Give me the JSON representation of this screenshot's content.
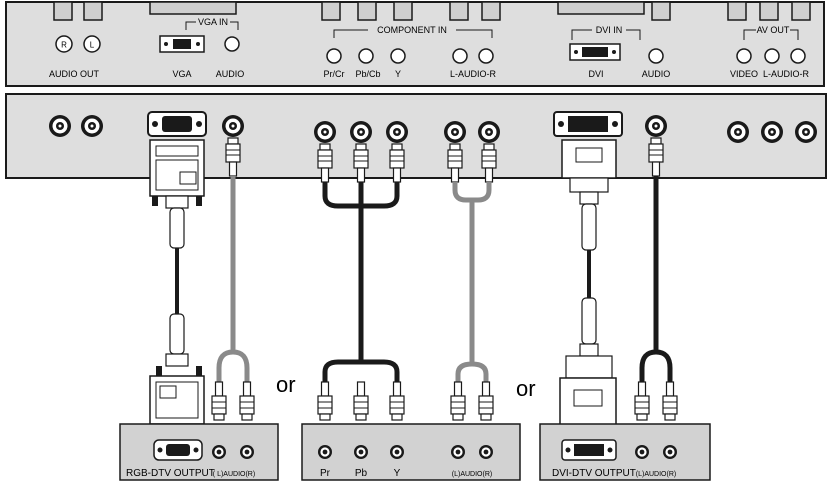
{
  "top_panel": {
    "labels": {
      "audio_out": "AUDIO OUT",
      "vga": "VGA",
      "vga_audio": "AUDIO",
      "vga_in": "VGA IN",
      "component_in": "COMPONENT  IN",
      "pr_cr": "Pr/Cr",
      "pb_cb": "Pb/Cb",
      "y": "Y",
      "l_audio_r": "L-AUDIO-R",
      "dvi_in": "DVI IN",
      "dvi": "DVI",
      "dvi_audio": "AUDIO",
      "av_out": "AV OUT",
      "video": "VIDEO",
      "av_l_audio_r": "L-AUDIO-R"
    },
    "audio_out_jacks": [
      "R",
      "L"
    ]
  },
  "or_labels": [
    "or",
    "or"
  ],
  "devices": {
    "rgb": {
      "title": "RGB-DTV OUTPUT",
      "audio": "( L)AUDIO(R)"
    },
    "component": {
      "pr": "Pr",
      "pb": "Pb",
      "y": "Y",
      "audio": "(L)AUDIO(R)"
    },
    "dvi": {
      "title": "DVI-DTV OUTPUT",
      "audio": "(L)AUDIO(R)"
    }
  },
  "colors": {
    "panel_fill": "#dedede",
    "device_fill": "#d2d2d2",
    "cable_black": "#1a1a1a",
    "cable_gray": "#8a8a8a"
  }
}
